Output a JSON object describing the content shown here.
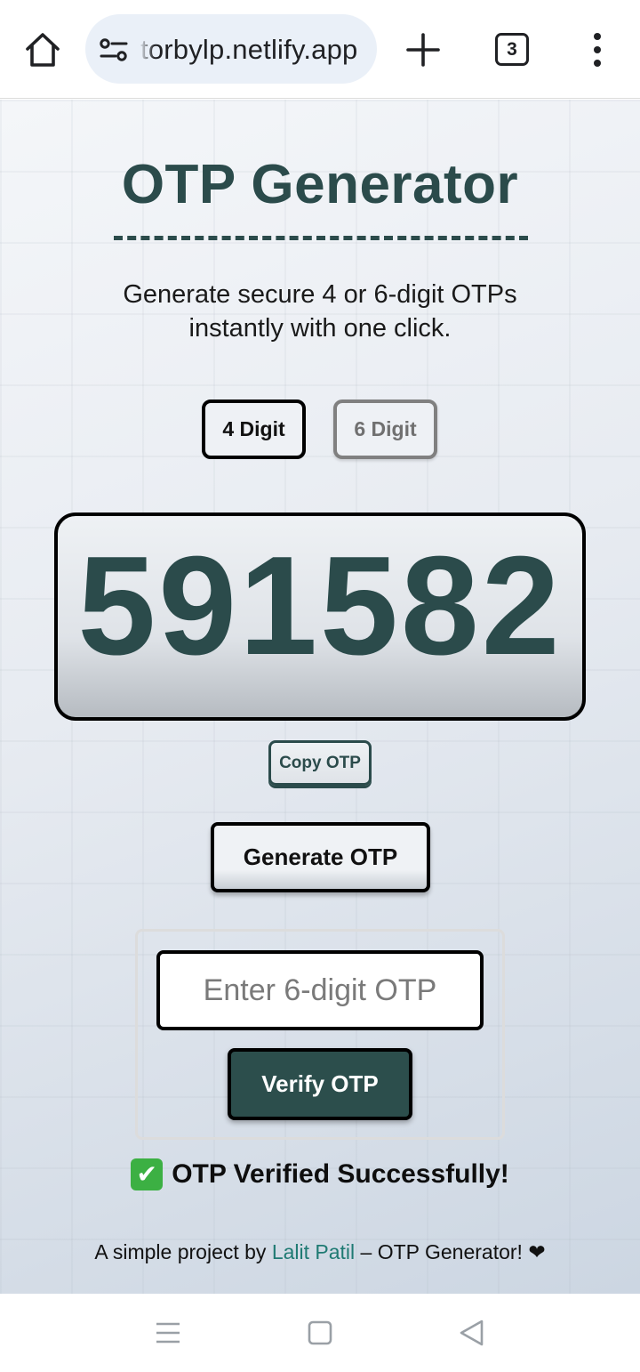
{
  "browser": {
    "url": "torbylp.netlify.app",
    "tab_count": "3"
  },
  "page": {
    "title": "OTP Generator",
    "subtitle": "Generate secure 4 or 6-digit OTPs instantly with one click.",
    "digit_options": [
      "4 Digit",
      "6 Digit"
    ],
    "otp_value": "591582",
    "copy_label": "Copy OTP",
    "generate_label": "Generate OTP",
    "verify_input_placeholder": "Enter 6-digit OTP",
    "verify_label": "Verify OTP",
    "status_icon": "✔",
    "status_text": "OTP Verified Successfully!",
    "footer_prefix": "A simple project by",
    "footer_author": "Lalit Patil",
    "footer_suffix": "– OTP Generator! ❤"
  },
  "colors": {
    "accent": "#2b4b4b",
    "verify_button": "#2c4e4c",
    "link": "#1f7a73",
    "success": "#3cb043"
  },
  "icons": {
    "home": "home-icon",
    "site_info": "site-settings-icon",
    "new_tab": "plus-icon",
    "tabs": "tab-switcher-icon",
    "menu": "more-vert-icon",
    "nav_menu": "menu-lines-icon",
    "nav_home": "square-home-icon",
    "nav_back": "triangle-back-icon"
  }
}
